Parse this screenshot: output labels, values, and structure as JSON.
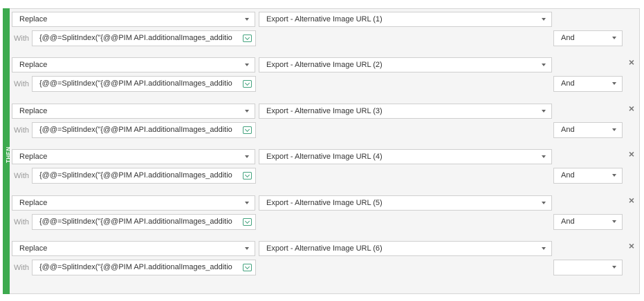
{
  "section": {
    "label": "THEN"
  },
  "rules": [
    {
      "action": "Replace",
      "target": "Export - Alternative Image URL (1)",
      "with_label": "With",
      "expression": "{@@=SplitIndex(\"{@@PIM API.additionalImages_additio",
      "conjunction": "And",
      "removable": false
    },
    {
      "action": "Replace",
      "target": "Export - Alternative Image URL (2)",
      "with_label": "With",
      "expression": "{@@=SplitIndex(\"{@@PIM API.additionalImages_additio",
      "conjunction": "And",
      "removable": true
    },
    {
      "action": "Replace",
      "target": "Export - Alternative Image URL (3)",
      "with_label": "With",
      "expression": "{@@=SplitIndex(\"{@@PIM API.additionalImages_additio",
      "conjunction": "And",
      "removable": true
    },
    {
      "action": "Replace",
      "target": "Export - Alternative Image URL (4)",
      "with_label": "With",
      "expression": "{@@=SplitIndex(\"{@@PIM API.additionalImages_additio",
      "conjunction": "And",
      "removable": true
    },
    {
      "action": "Replace",
      "target": "Export - Alternative Image URL (5)",
      "with_label": "With",
      "expression": "{@@=SplitIndex(\"{@@PIM API.additionalImages_additio",
      "conjunction": "And",
      "removable": true
    },
    {
      "action": "Replace",
      "target": "Export - Alternative Image URL (6)",
      "with_label": "With",
      "expression": "{@@=SplitIndex(\"{@@PIM API.additionalImages_additio",
      "conjunction": "",
      "removable": true
    }
  ],
  "icons": {
    "dropdown": "chevron-down-icon",
    "remove": "close-icon",
    "expression_picker": "expand-icon"
  },
  "colors": {
    "then_bar": "#3daa4f",
    "panel_bg": "#f5f5f5",
    "picker_accent": "#44a37e"
  }
}
